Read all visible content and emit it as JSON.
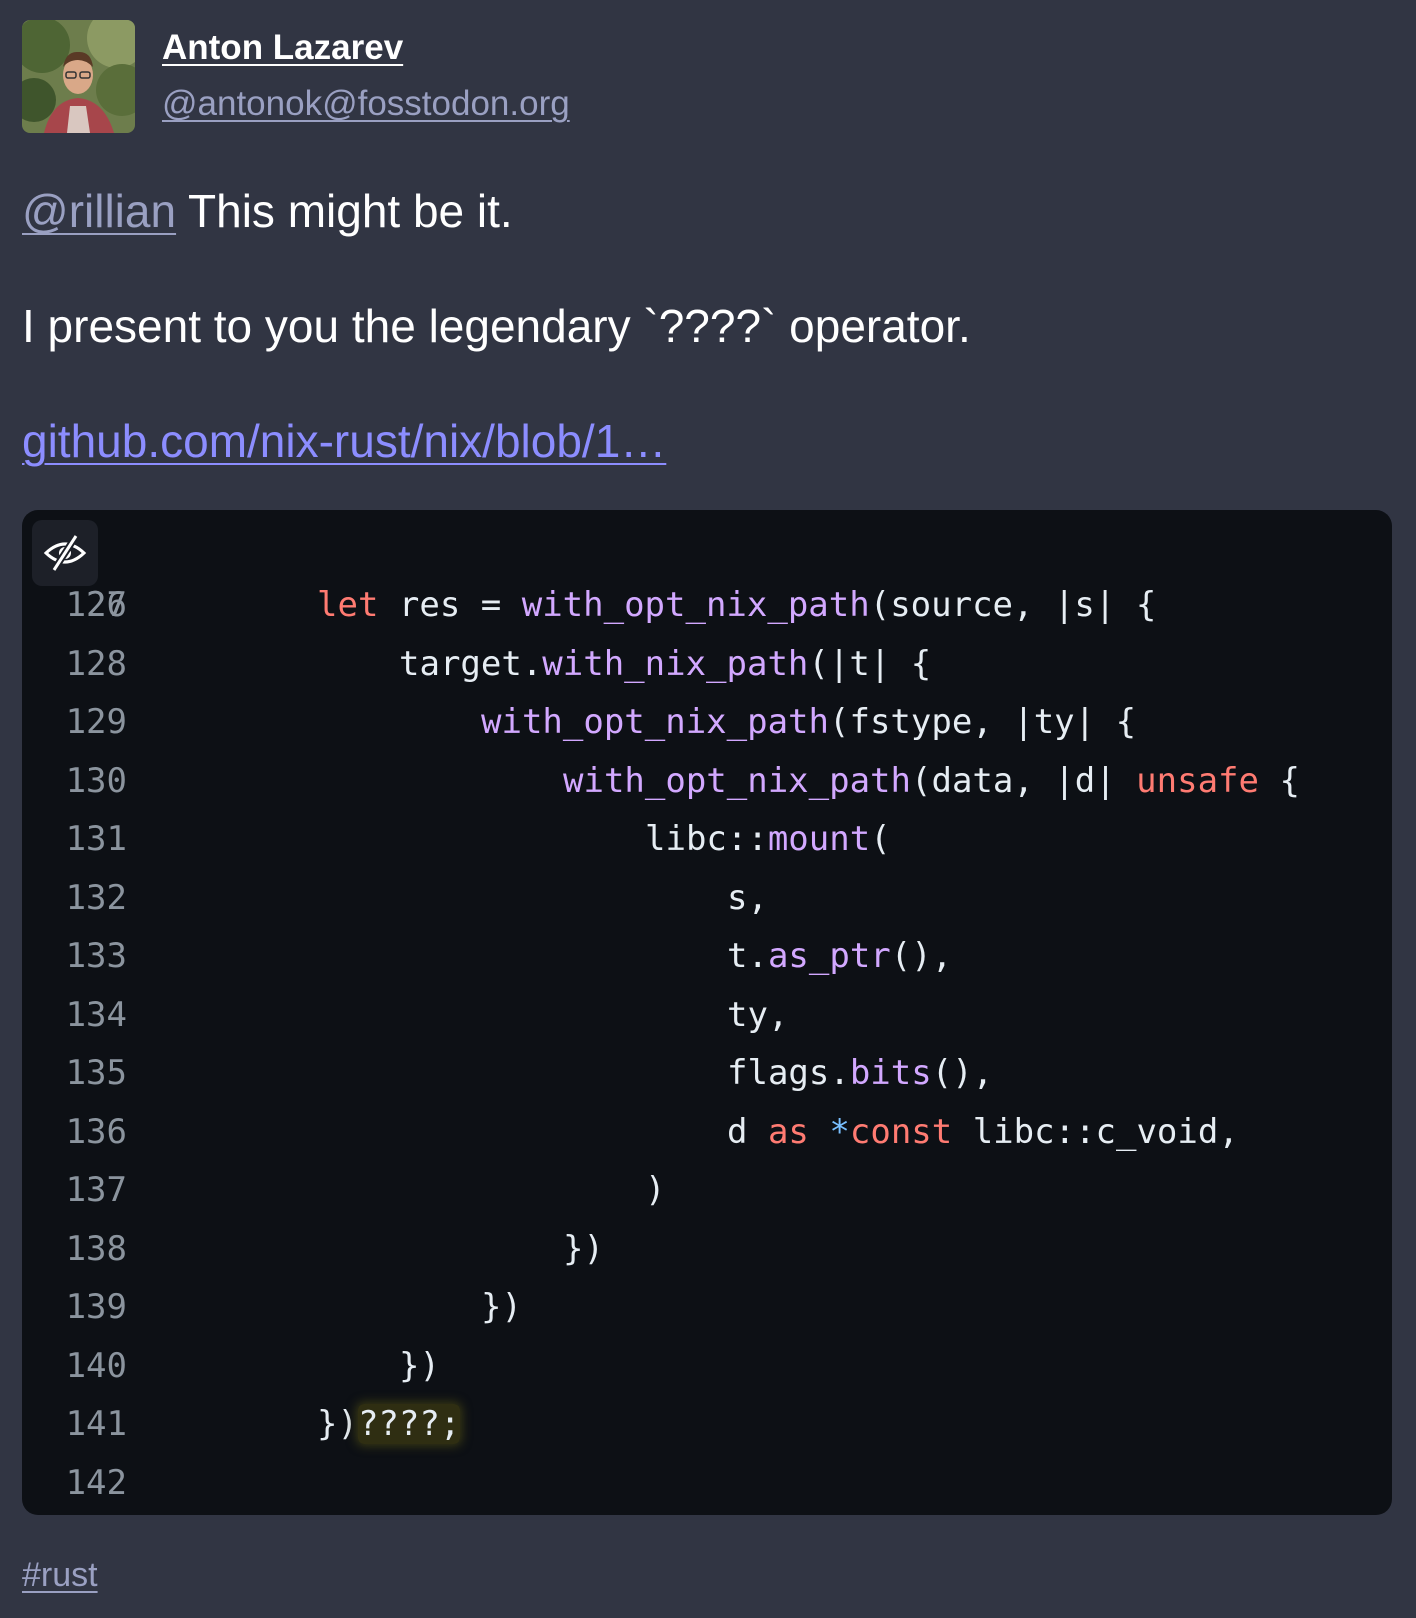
{
  "author": {
    "name": "Anton Lazarev",
    "handle": "@antonok@fosstodon.org"
  },
  "post": {
    "mention": "@rillian",
    "line1_rest": " This might be it.",
    "line2": "I present to you the legendary `????` operator.",
    "link_text": "github.com/nix-rust/nix/blob/1…",
    "hashtag": "#rust"
  },
  "code_card": {
    "hide_button_icon": "eye-slash-icon",
    "partial_first_line_number": "26",
    "lines": [
      {
        "n": "127",
        "indent": 0,
        "tokens": [
          {
            "t": "let",
            "c": "kw"
          },
          {
            "t": " res = "
          },
          {
            "t": "with_opt_nix_path",
            "c": "fn"
          },
          {
            "t": "(source, |s| {"
          }
        ]
      },
      {
        "n": "128",
        "indent": 4,
        "tokens": [
          {
            "t": "target."
          },
          {
            "t": "with_nix_path",
            "c": "fn"
          },
          {
            "t": "(|t| {"
          }
        ]
      },
      {
        "n": "129",
        "indent": 8,
        "tokens": [
          {
            "t": "with_opt_nix_path",
            "c": "fn"
          },
          {
            "t": "(fstype, |ty| {"
          }
        ]
      },
      {
        "n": "130",
        "indent": 12,
        "tokens": [
          {
            "t": "with_opt_nix_path",
            "c": "fn"
          },
          {
            "t": "(data, |d| "
          },
          {
            "t": "unsafe",
            "c": "kw"
          },
          {
            "t": " {"
          }
        ]
      },
      {
        "n": "131",
        "indent": 16,
        "tokens": [
          {
            "t": "libc::"
          },
          {
            "t": "mount",
            "c": "fn"
          },
          {
            "t": "("
          }
        ]
      },
      {
        "n": "132",
        "indent": 20,
        "tokens": [
          {
            "t": "s,"
          }
        ]
      },
      {
        "n": "133",
        "indent": 20,
        "tokens": [
          {
            "t": "t."
          },
          {
            "t": "as_ptr",
            "c": "fn"
          },
          {
            "t": "(),"
          }
        ]
      },
      {
        "n": "134",
        "indent": 20,
        "tokens": [
          {
            "t": "ty,"
          }
        ]
      },
      {
        "n": "135",
        "indent": 20,
        "tokens": [
          {
            "t": "flags."
          },
          {
            "t": "bits",
            "c": "fn"
          },
          {
            "t": "(),"
          }
        ]
      },
      {
        "n": "136",
        "indent": 20,
        "tokens": [
          {
            "t": "d "
          },
          {
            "t": "as",
            "c": "kw"
          },
          {
            "t": " "
          },
          {
            "t": "*",
            "c": "op"
          },
          {
            "t": "const",
            "c": "kw"
          },
          {
            "t": " libc::c_void,"
          }
        ]
      },
      {
        "n": "137",
        "indent": 16,
        "tokens": [
          {
            "t": ")"
          }
        ]
      },
      {
        "n": "138",
        "indent": 12,
        "tokens": [
          {
            "t": "})"
          }
        ]
      },
      {
        "n": "139",
        "indent": 8,
        "tokens": [
          {
            "t": "})"
          }
        ]
      },
      {
        "n": "140",
        "indent": 4,
        "tokens": [
          {
            "t": "})"
          }
        ]
      },
      {
        "n": "141",
        "indent": 0,
        "tokens": [
          {
            "t": "})"
          },
          {
            "t": "????;",
            "c": "hl"
          }
        ]
      },
      {
        "n": "142",
        "indent": 0,
        "tokens": []
      }
    ]
  }
}
